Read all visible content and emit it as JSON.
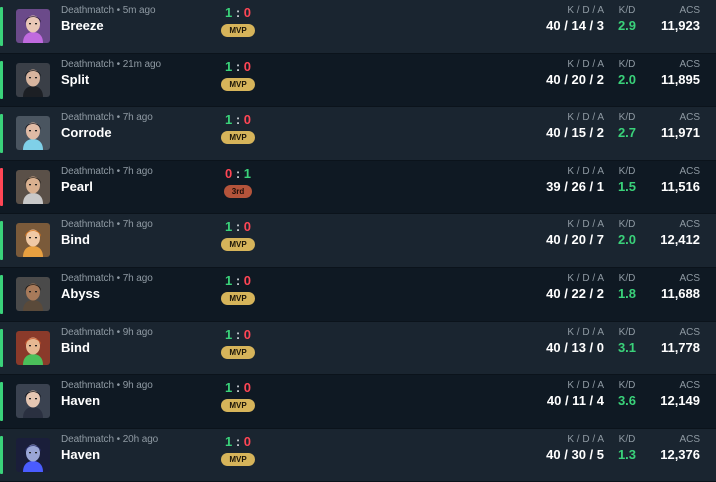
{
  "colors": {
    "win": "#3ad27a",
    "loss": "#ff4655",
    "mvp": "#d6b45a",
    "place": "#b4543b"
  },
  "headers": {
    "kda": "K / D / A",
    "kd": "K/D",
    "acs": "ACS"
  },
  "matches": [
    {
      "mode": "Deathmatch",
      "time": "5m ago",
      "map": "Breeze",
      "score_a": "1",
      "score_b": "0",
      "badge": "MVP",
      "result": "win",
      "kda": "40 / 14 / 3",
      "kd": "2.9",
      "acs": "11,923",
      "agent_icon": "purple-hood-agent"
    },
    {
      "mode": "Deathmatch",
      "time": "21m ago",
      "map": "Split",
      "score_a": "1",
      "score_b": "0",
      "badge": "MVP",
      "result": "win",
      "kda": "40 / 20 / 2",
      "kd": "2.0",
      "acs": "11,895",
      "agent_icon": "masked-agent"
    },
    {
      "mode": "Deathmatch",
      "time": "7h ago",
      "map": "Corrode",
      "score_a": "1",
      "score_b": "0",
      "badge": "MVP",
      "result": "win",
      "kda": "40 / 15 / 2",
      "kd": "2.7",
      "acs": "11,971",
      "agent_icon": "dark-hair-agent"
    },
    {
      "mode": "Deathmatch",
      "time": "7h ago",
      "map": "Pearl",
      "score_a": "0",
      "score_b": "1",
      "badge": "3rd",
      "result": "loss",
      "kda": "39 / 26 / 1",
      "kd": "1.5",
      "acs": "11,516",
      "agent_icon": "visor-agent"
    },
    {
      "mode": "Deathmatch",
      "time": "7h ago",
      "map": "Bind",
      "score_a": "1",
      "score_b": "0",
      "badge": "MVP",
      "result": "win",
      "kda": "40 / 20 / 7",
      "kd": "2.0",
      "acs": "12,412",
      "agent_icon": "orange-hair-agent"
    },
    {
      "mode": "Deathmatch",
      "time": "7h ago",
      "map": "Abyss",
      "score_a": "1",
      "score_b": "0",
      "badge": "MVP",
      "result": "win",
      "kda": "40 / 22 / 2",
      "kd": "1.8",
      "acs": "11,688",
      "agent_icon": "bearded-agent"
    },
    {
      "mode": "Deathmatch",
      "time": "9h ago",
      "map": "Bind",
      "score_a": "1",
      "score_b": "0",
      "badge": "MVP",
      "result": "win",
      "kda": "40 / 13 / 0",
      "kd": "3.1",
      "acs": "11,778",
      "agent_icon": "headband-agent"
    },
    {
      "mode": "Deathmatch",
      "time": "9h ago",
      "map": "Haven",
      "score_a": "1",
      "score_b": "0",
      "badge": "MVP",
      "result": "win",
      "kda": "40 / 11 / 4",
      "kd": "3.6",
      "acs": "12,149",
      "agent_icon": "black-hair-agent"
    },
    {
      "mode": "Deathmatch",
      "time": "20h ago",
      "map": "Haven",
      "score_a": "1",
      "score_b": "0",
      "badge": "MVP",
      "result": "win",
      "kda": "40 / 30 / 5",
      "kd": "1.3",
      "acs": "12,376",
      "agent_icon": "helmet-agent"
    }
  ]
}
